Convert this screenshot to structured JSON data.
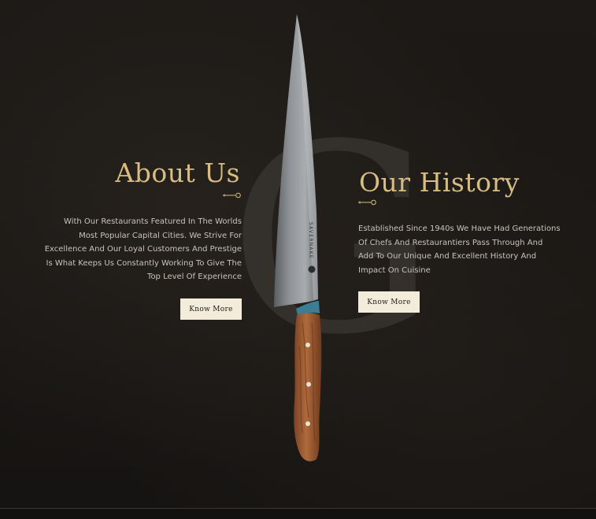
{
  "watermark": {
    "letter": "G"
  },
  "about": {
    "title": "About Us",
    "text_lines": [
      "With Our Restaurants Featured In The Worlds",
      "Most Popular Capital Cities. We Strive For",
      "Excellence And Our Loyal Customers And Prestige",
      "Is What Keeps Us Constantly Working To Give The",
      "Top Level Of Experience"
    ],
    "button_label": "Know More"
  },
  "history": {
    "title": "Our History",
    "text_lines": [
      "Established Since 1940s We Have Had Generations",
      "Of Chefs And Restaurantiers Pass Through And",
      "Add To Our Unique And Excellent History And",
      "Impact On Cuisine"
    ],
    "button_label": "Know More"
  },
  "knife": {
    "brand_text": "SAVERNAKE"
  },
  "icons": {
    "divider": "key-ornament-icon",
    "knife": "chef-knife-image"
  },
  "colors": {
    "background": "#1a1715",
    "gold": "#d8bd82",
    "text": "#c9c3b9",
    "button_bg": "#f4ecdb",
    "button_text": "#1f1b17"
  }
}
